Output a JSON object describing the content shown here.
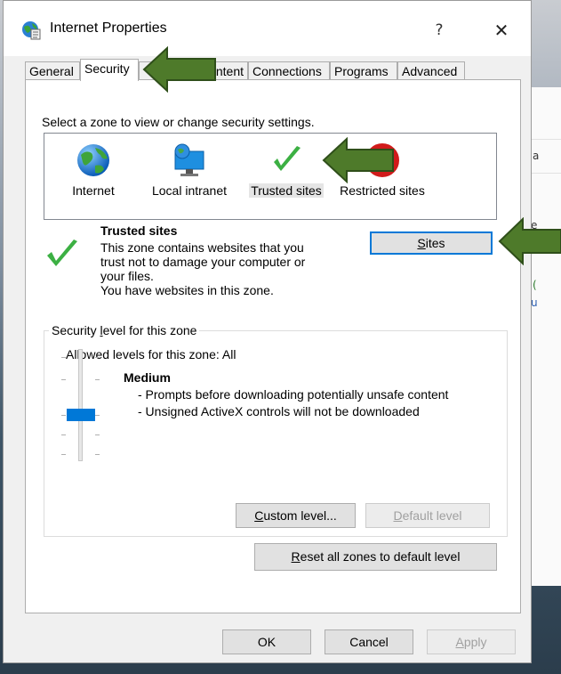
{
  "window": {
    "title": "Internet Properties",
    "help_glyph": "?",
    "close_glyph": "✕"
  },
  "tabs": [
    {
      "label": "General"
    },
    {
      "label": "Security"
    },
    {
      "label": "ntent"
    },
    {
      "label": "Connections"
    },
    {
      "label": "Programs"
    },
    {
      "label": "Advanced"
    }
  ],
  "security": {
    "zone_prompt": "Select a zone to view or change security settings.",
    "zones": [
      {
        "label": "Internet",
        "icon": "globe-icon"
      },
      {
        "label": "Local intranet",
        "icon": "network-computer-icon"
      },
      {
        "label": "Trusted sites",
        "icon": "checkmark-icon"
      },
      {
        "label": "Restricted sites",
        "icon": "restricted-icon"
      }
    ],
    "selected_zone": {
      "title": "Trusted sites",
      "desc_line1": "This zone contains websites that you",
      "desc_line2": "trust not to damage your computer or",
      "desc_line3": "your files.",
      "desc_line4": "You have websites in this zone."
    },
    "sites_button": {
      "u": "S",
      "rest": "ites"
    },
    "level_group": {
      "legend_pre": "Security ",
      "legend_u": "l",
      "legend_post": "evel for this zone",
      "allowed": "Allowed levels for this zone: All",
      "level_name": "Medium",
      "bullet1": "- Prompts before downloading potentially unsafe content",
      "bullet2": "- Unsigned ActiveX controls will not be downloaded",
      "slider_position_fraction": 0.5
    },
    "custom_level": {
      "u": "C",
      "rest": "ustom level..."
    },
    "default_level": {
      "u": "D",
      "rest": "efault level"
    },
    "reset_all": {
      "u": "R",
      "rest": "eset all zones to default level"
    }
  },
  "footer": {
    "ok": "OK",
    "cancel": "Cancel",
    "apply_u": "A",
    "apply_rest": "pply"
  },
  "background_window": {
    "chars": [
      "a",
      "e",
      "(",
      "u"
    ]
  },
  "colors": {
    "accent": "#0078d7",
    "annotation_arrow": "#4e7a2a",
    "annotation_arrow_border": "#2f4f1a",
    "check_green": "#3cb043"
  }
}
